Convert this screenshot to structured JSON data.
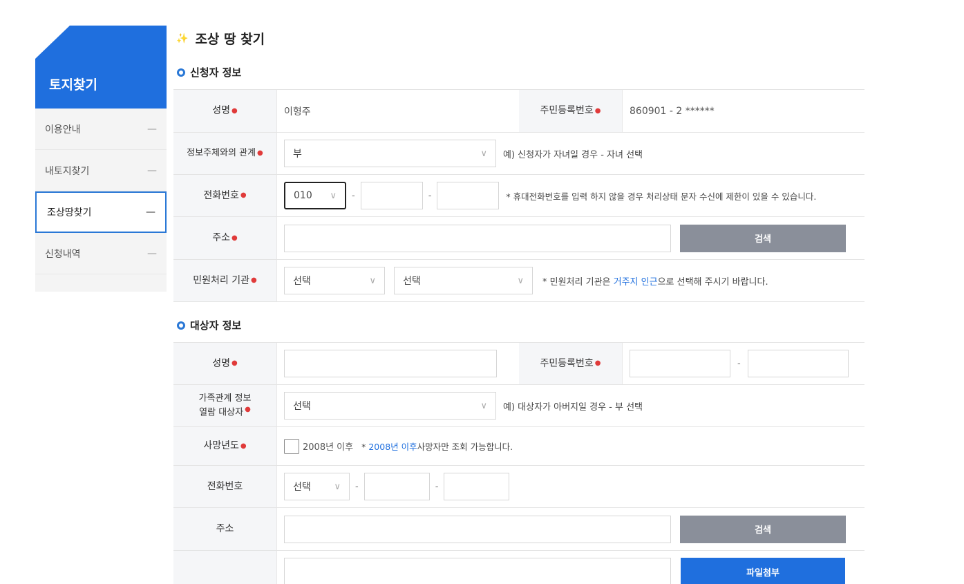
{
  "sidebar": {
    "title": "토지찾기",
    "items": [
      {
        "label": "이용안내",
        "dash": "—"
      },
      {
        "label": "내토지찾기",
        "dash": "—"
      },
      {
        "label": "조상땅찾기",
        "dash": "—"
      },
      {
        "label": "신청내역",
        "dash": "—"
      }
    ]
  },
  "page": {
    "title": "조상 땅 찾기"
  },
  "applicant": {
    "section_title": "신청자 정보",
    "name_label": "성명",
    "name_value": "이형주",
    "rrn_label": "주민등록번호",
    "rrn_value": "860901 - 2 ******",
    "relation_label": "정보주체와의 관계",
    "relation_value": "부",
    "relation_hint": "예) 신청자가 자녀일 경우 - 자녀 선택",
    "phone_label": "전화번호",
    "phone_prefix": "010",
    "phone_sep": "-",
    "phone_hint": "* 휴대전화번호를 입력 하지 않을 경우 처리상태 문자 수신에 제한이 있을 수 있습니다.",
    "address_label": "주소",
    "search_button": "검색",
    "office_label": "민원처리 기관",
    "office_select1": "선택",
    "office_select2": "선택",
    "office_hint_prefix": "* 민원처리 기관은 ",
    "office_hint_link": "거주지 인근",
    "office_hint_suffix": "으로 선택해 주시기 바랍니다."
  },
  "target": {
    "section_title": "대상자 정보",
    "name_label": "성명",
    "rrn_label": "주민등록번호",
    "rrn_sep": "-",
    "family_label_line1": "가족관계 정보",
    "family_label_line2": "열람 대상자",
    "family_select": "선택",
    "family_hint": "예) 대상자가 아버지일 경우 - 부 선택",
    "death_label": "사망년도",
    "death_checkbox_label": "2008년 이후",
    "death_hint_prefix": "* ",
    "death_hint_link": "2008년 이후",
    "death_hint_suffix": "사망자만 조회 가능합니다.",
    "phone_label": "전화번호",
    "phone_select": "선택",
    "phone_sep": "-",
    "address_label": "주소",
    "search_button": "검색",
    "attach_button": "파일첨부"
  },
  "icons": {
    "chevron": "chevron-down-icon",
    "title": "pencil-icon",
    "section": "ring-icon"
  },
  "colors": {
    "accent": "#1f6fde",
    "required": "#e03a3a",
    "gray_button": "#8a8f9a"
  }
}
